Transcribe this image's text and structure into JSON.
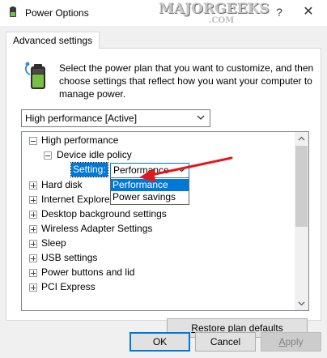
{
  "window": {
    "title": "Power Options",
    "watermark": "MAJORGEEKS",
    "watermark_suffix": ".COM",
    "help_glyph": "?",
    "close_glyph": "✕"
  },
  "tabs": [
    {
      "label": "Advanced settings",
      "active": true
    }
  ],
  "description": "Select the power plan that you want to customize, and then choose settings that reflect how you want your computer to manage power.",
  "plan_dropdown": {
    "value": "High performance [Active]"
  },
  "tree": {
    "items": [
      {
        "label": "High performance",
        "expander": "minus",
        "level": 0
      },
      {
        "label": "Device idle policy",
        "expander": "minus",
        "level": 1
      },
      {
        "label": "Hard disk",
        "expander": "plus",
        "level": 0
      },
      {
        "label": "Internet Explorer",
        "expander": "plus",
        "level": 0
      },
      {
        "label": "Desktop background settings",
        "expander": "plus",
        "level": 0
      },
      {
        "label": "Wireless Adapter Settings",
        "expander": "plus",
        "level": 0
      },
      {
        "label": "Sleep",
        "expander": "plus",
        "level": 0
      },
      {
        "label": "USB settings",
        "expander": "plus",
        "level": 0
      },
      {
        "label": "Power buttons and lid",
        "expander": "plus",
        "level": 0
      },
      {
        "label": "PCI Express",
        "expander": "plus",
        "level": 0
      }
    ],
    "setting_label": "Setting:",
    "setting_value": "Performance",
    "setting_options": [
      "Performance",
      "Power savings"
    ],
    "selected_option": "Performance"
  },
  "buttons": {
    "restore_prefix": "R",
    "restore_rest": "estore plan defaults",
    "ok": "OK",
    "cancel": "Cancel",
    "apply_prefix": "A",
    "apply_rest": "pply",
    "apply_enabled": false
  },
  "colors": {
    "accent": "#0078d7",
    "annotation_arrow": "#e3171a"
  }
}
